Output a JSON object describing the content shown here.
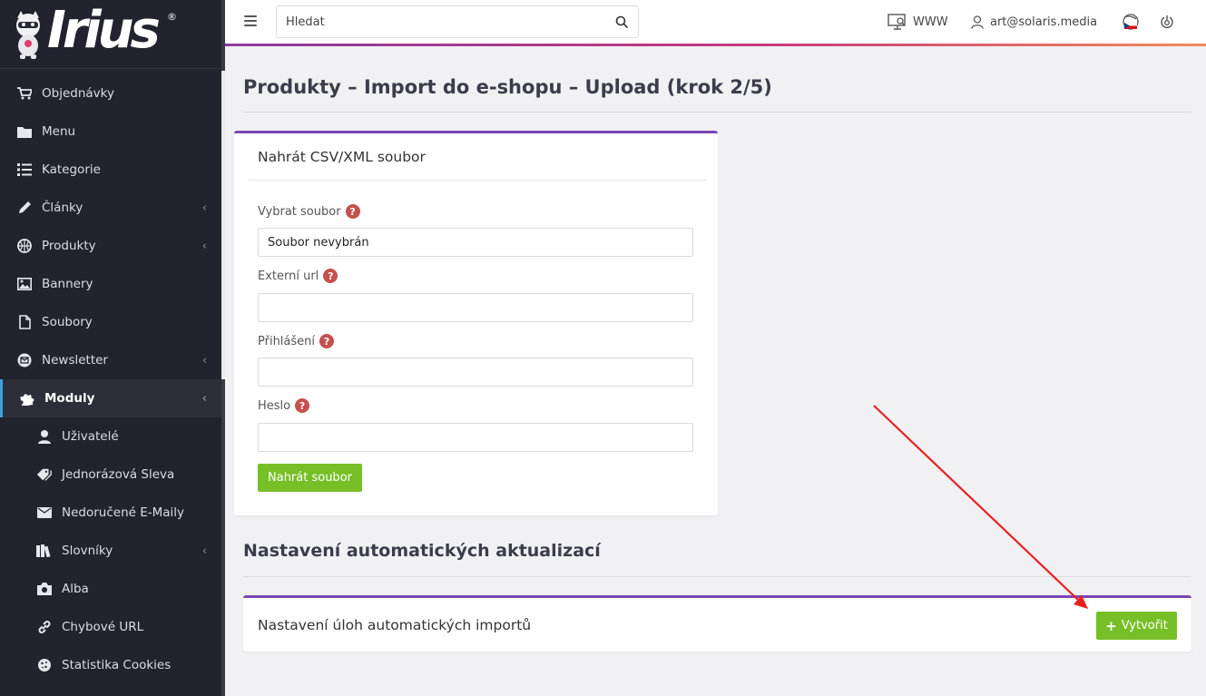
{
  "brand": {
    "name": "Irius",
    "reg": "®"
  },
  "sidebar": {
    "items": [
      {
        "label": "Objednávky",
        "icon": "cart-icon",
        "chevron": false
      },
      {
        "label": "Menu",
        "icon": "folder-icon",
        "chevron": false
      },
      {
        "label": "Kategorie",
        "icon": "list-icon",
        "chevron": false
      },
      {
        "label": "Články",
        "icon": "pen-icon",
        "chevron": true
      },
      {
        "label": "Produkty",
        "icon": "basketball-icon",
        "chevron": true
      },
      {
        "label": "Bannery",
        "icon": "image-icon",
        "chevron": false
      },
      {
        "label": "Soubory",
        "icon": "file-icon",
        "chevron": false
      },
      {
        "label": "Newsletter",
        "icon": "mail-circle-icon",
        "chevron": true
      },
      {
        "label": "Moduly",
        "icon": "puzzle-icon",
        "chevron": true,
        "active": true
      }
    ],
    "subitems": [
      {
        "label": "Uživatelé",
        "icon": "user-icon"
      },
      {
        "label": "Jednorázová Sleva",
        "icon": "tags-icon"
      },
      {
        "label": "Nedoručené E-Maily",
        "icon": "mail-icon"
      },
      {
        "label": "Slovníky",
        "icon": "books-icon",
        "chevron": true
      },
      {
        "label": "Alba",
        "icon": "camera-icon"
      },
      {
        "label": "Chybové URL",
        "icon": "link-icon"
      },
      {
        "label": "Statistika Cookies",
        "icon": "cookie-icon"
      }
    ]
  },
  "topbar": {
    "search_placeholder": "Hledat",
    "www_label": "WWW",
    "user_email": "art@solaris.media"
  },
  "page": {
    "title": "Produkty – Import do e-shopu – Upload (krok 2/5)",
    "upload_card": {
      "title": "Nahrát CSV/XML soubor",
      "file_label": "Vybrat soubor",
      "file_value": "Soubor nevybrán",
      "url_label": "Externí url",
      "login_label": "Přihlášení",
      "password_label": "Heslo",
      "help_glyph": "?",
      "submit_label": "Nahrát soubor"
    },
    "auto_section_title": "Nastavení automatických aktualizací",
    "auto_card": {
      "title": "Nastavení úloh automatických importů",
      "create_label": "Vytvořit"
    }
  },
  "colors": {
    "sidebar_bg": "#23232f",
    "accent_purple": "#7b45b6",
    "button_green": "#77bf27",
    "help_red": "#c6504e",
    "annotation_arrow": "#e8201f"
  }
}
